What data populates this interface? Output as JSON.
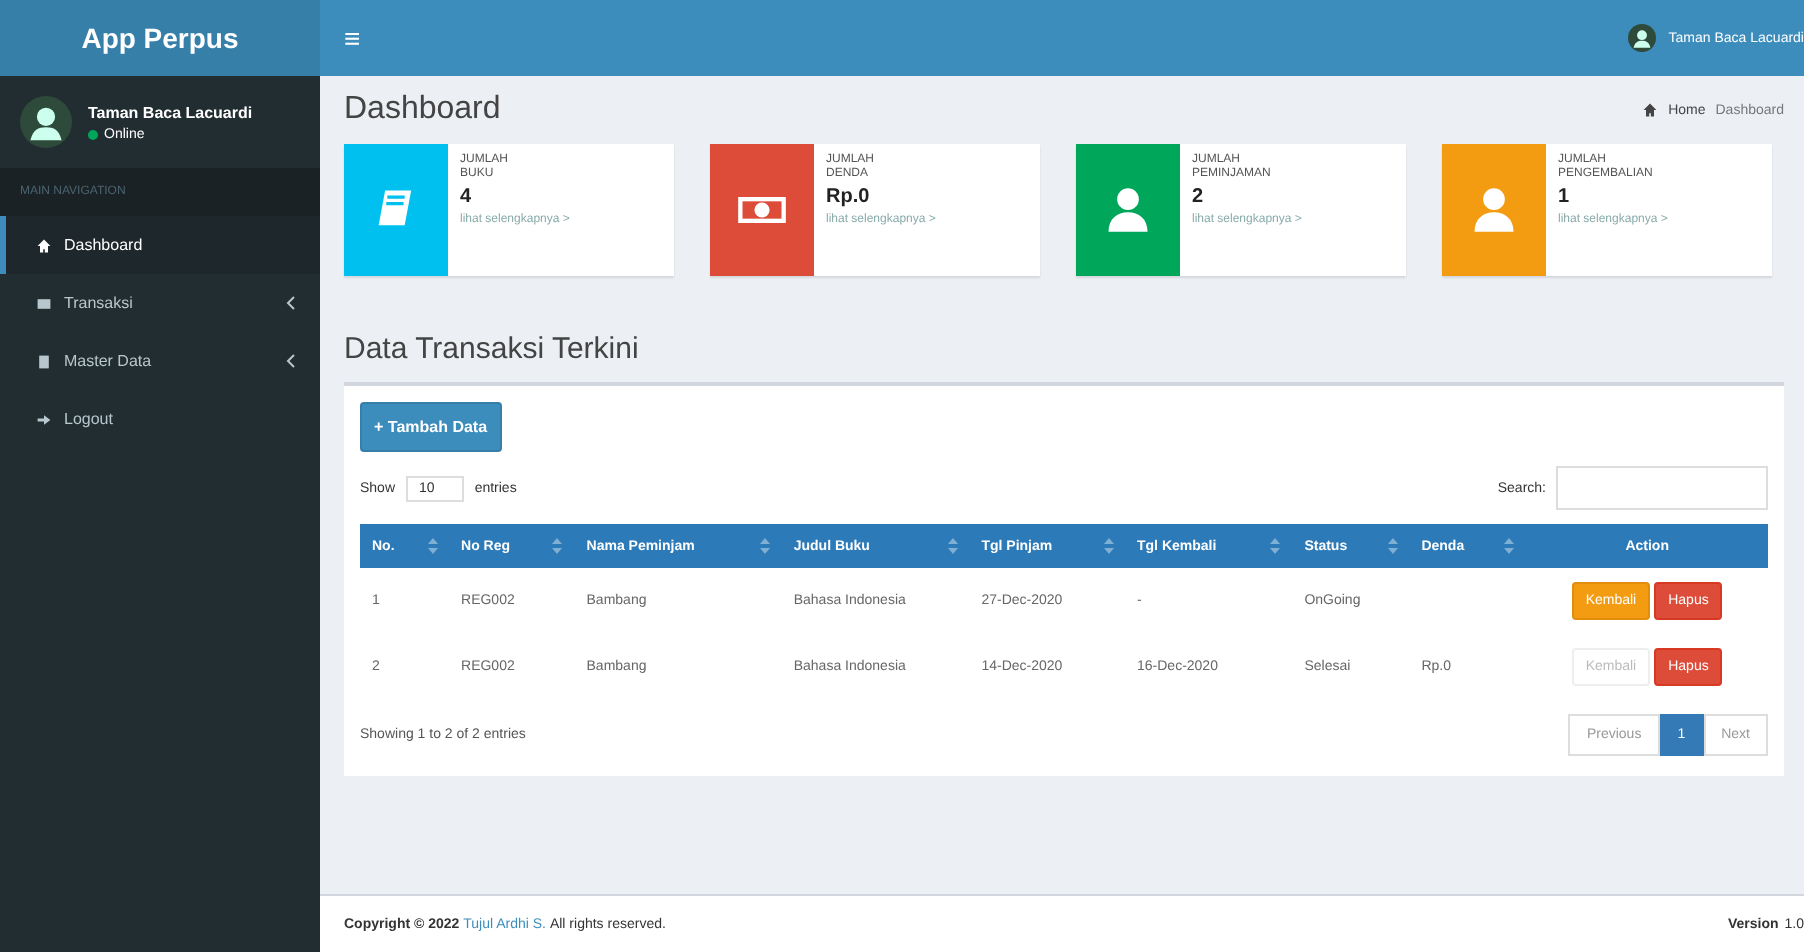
{
  "sidebar": {
    "brand": "App Perpus",
    "user": {
      "name": "Taman Baca Lacuardi",
      "status": "Online"
    },
    "section_header": "MAIN NAVIGATION",
    "items": [
      {
        "label": "Dashboard",
        "kind": "home",
        "selected": true,
        "expandable": false
      },
      {
        "label": "Transaksi",
        "kind": "table",
        "selected": false,
        "expandable": true
      },
      {
        "label": "Master Data",
        "kind": "file",
        "selected": false,
        "expandable": true
      },
      {
        "label": "Logout",
        "kind": "signout",
        "selected": false,
        "expandable": false
      }
    ]
  },
  "topbar": {
    "menu_glyph": "≡",
    "user_name": "Taman Baca Lacuardi"
  },
  "page": {
    "title": "Dashboard",
    "breadcrumb": [
      "Home",
      "Dashboard"
    ]
  },
  "info_boxes": [
    {
      "label_1": "JUMLAH",
      "label_2": "BUKU",
      "value": "4",
      "link": "lihat selengkapnya >",
      "kind": "book",
      "color": "#00c0ef"
    },
    {
      "label_1": "JUMLAH",
      "label_2": "DENDA",
      "value": "Rp.0",
      "link": "lihat selengkapnya >",
      "kind": "money",
      "color": "#dd4b39"
    },
    {
      "label_1": "JUMLAH",
      "label_2": "PEMINJAMAN",
      "value": "2",
      "link": "lihat selengkapnya >",
      "kind": "user",
      "color": "#00a65a"
    },
    {
      "label_1": "JUMLAH",
      "label_2": "PENGEMBALIAN",
      "value": "1",
      "link": "lihat selengkapnya >",
      "kind": "user",
      "color": "#f39c12"
    }
  ],
  "table_box": {
    "title": "Data Transaksi Terkini",
    "add_button": "+ Tambah Data",
    "show_label": "Show",
    "page_size": "10",
    "entries_label": "entries",
    "search_label": "Search:",
    "columns": [
      "No.",
      "No Reg",
      "Nama Peminjam",
      "Judul Buku",
      "Tgl Pinjam",
      "Tgl Kembali",
      "Status",
      "Denda",
      "Action"
    ],
    "rows": [
      {
        "cells": [
          "1",
          "REG002",
          "Bambang",
          "Bahasa Indonesia",
          "27-Dec-2020",
          "-",
          "OnGoing",
          ""
        ],
        "actions": [
          {
            "label": "Kembali",
            "kind": "warning",
            "disabled": false
          },
          {
            "label": "Hapus",
            "kind": "danger",
            "disabled": false
          }
        ]
      },
      {
        "cells": [
          "2",
          "REG002",
          "Bambang",
          "Bahasa Indonesia",
          "14-Dec-2020",
          "16-Dec-2020",
          "Selesai",
          "Rp.0"
        ],
        "actions": [
          {
            "label": "Kembali",
            "kind": "warning",
            "disabled": true
          },
          {
            "label": "Hapus",
            "kind": "danger",
            "disabled": false
          }
        ]
      }
    ],
    "info": "Showing 1 to 2 of 2 entries",
    "pagination": [
      {
        "label": "Previous",
        "selected": false
      },
      {
        "label": "1",
        "selected": true
      },
      {
        "label": "Next",
        "selected": false
      }
    ]
  },
  "footer": {
    "copyright_prefix": "Copyright © 2022",
    "author": "Tujul Ardhi S.",
    "rights": "All rights reserved.",
    "version_label": "Version",
    "version": "1.0"
  }
}
